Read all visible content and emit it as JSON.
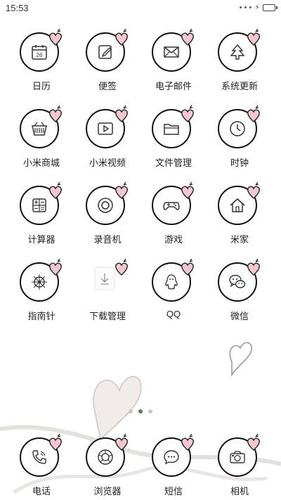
{
  "status_bar": {
    "time": "15:53",
    "signal_dots": "• • •",
    "charging_symbol": "⚡"
  },
  "apps": [
    {
      "id": "calendar",
      "label": "日历",
      "icon": "calendar-icon",
      "date_number": "26"
    },
    {
      "id": "notes",
      "label": "便签",
      "icon": "notes-icon"
    },
    {
      "id": "email",
      "label": "电子邮件",
      "icon": "email-icon"
    },
    {
      "id": "updater",
      "label": "系统更新",
      "icon": "system-update-icon"
    },
    {
      "id": "mall",
      "label": "小米商城",
      "icon": "shopping-basket-icon"
    },
    {
      "id": "video",
      "label": "小米视频",
      "icon": "video-play-icon"
    },
    {
      "id": "files",
      "label": "文件管理",
      "icon": "folder-icon"
    },
    {
      "id": "clock",
      "label": "时钟",
      "icon": "clock-icon"
    },
    {
      "id": "calculator",
      "label": "计算器",
      "icon": "calculator-icon"
    },
    {
      "id": "recorder",
      "label": "录音机",
      "icon": "recorder-icon"
    },
    {
      "id": "games",
      "label": "游戏",
      "icon": "gamepad-icon"
    },
    {
      "id": "mihome",
      "label": "米家",
      "icon": "home-icon"
    },
    {
      "id": "compass",
      "label": "指南针",
      "icon": "compass-icon"
    },
    {
      "id": "downloads",
      "label": "下载管理",
      "icon": "download-icon"
    },
    {
      "id": "qq",
      "label": "QQ",
      "icon": "qq-penguin-icon"
    },
    {
      "id": "wechat",
      "label": "微信",
      "icon": "wechat-icon"
    }
  ],
  "dock": [
    {
      "id": "phone",
      "label": "电话",
      "icon": "phone-icon"
    },
    {
      "id": "browser",
      "label": "浏览器",
      "icon": "browser-icon"
    },
    {
      "id": "sms",
      "label": "短信",
      "icon": "message-icon"
    },
    {
      "id": "camera",
      "label": "相机",
      "icon": "camera-icon"
    }
  ],
  "pager": {
    "pages": 3,
    "active_index": 1
  },
  "colors": {
    "ring": "#111111",
    "heart_fill": "#f2c7cf",
    "background": "#ffffff"
  }
}
